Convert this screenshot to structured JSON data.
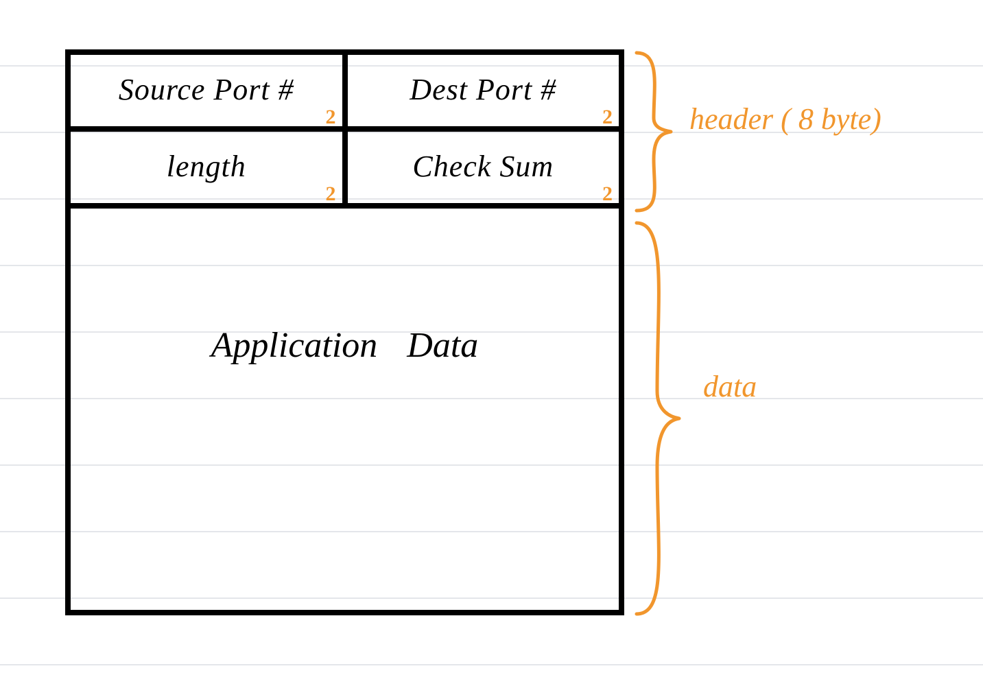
{
  "diagram": {
    "header_fields": {
      "source_port": {
        "label": "Source Port #",
        "size": "2"
      },
      "dest_port": {
        "label": "Dest  Port  #",
        "size": "2"
      },
      "length": {
        "label": "length",
        "size": "2"
      },
      "checksum": {
        "label": "Check Sum",
        "size": "2"
      }
    },
    "payload_label": "Application   Data",
    "annotations": {
      "header": "header ( 8 byte)",
      "data": "data"
    }
  }
}
